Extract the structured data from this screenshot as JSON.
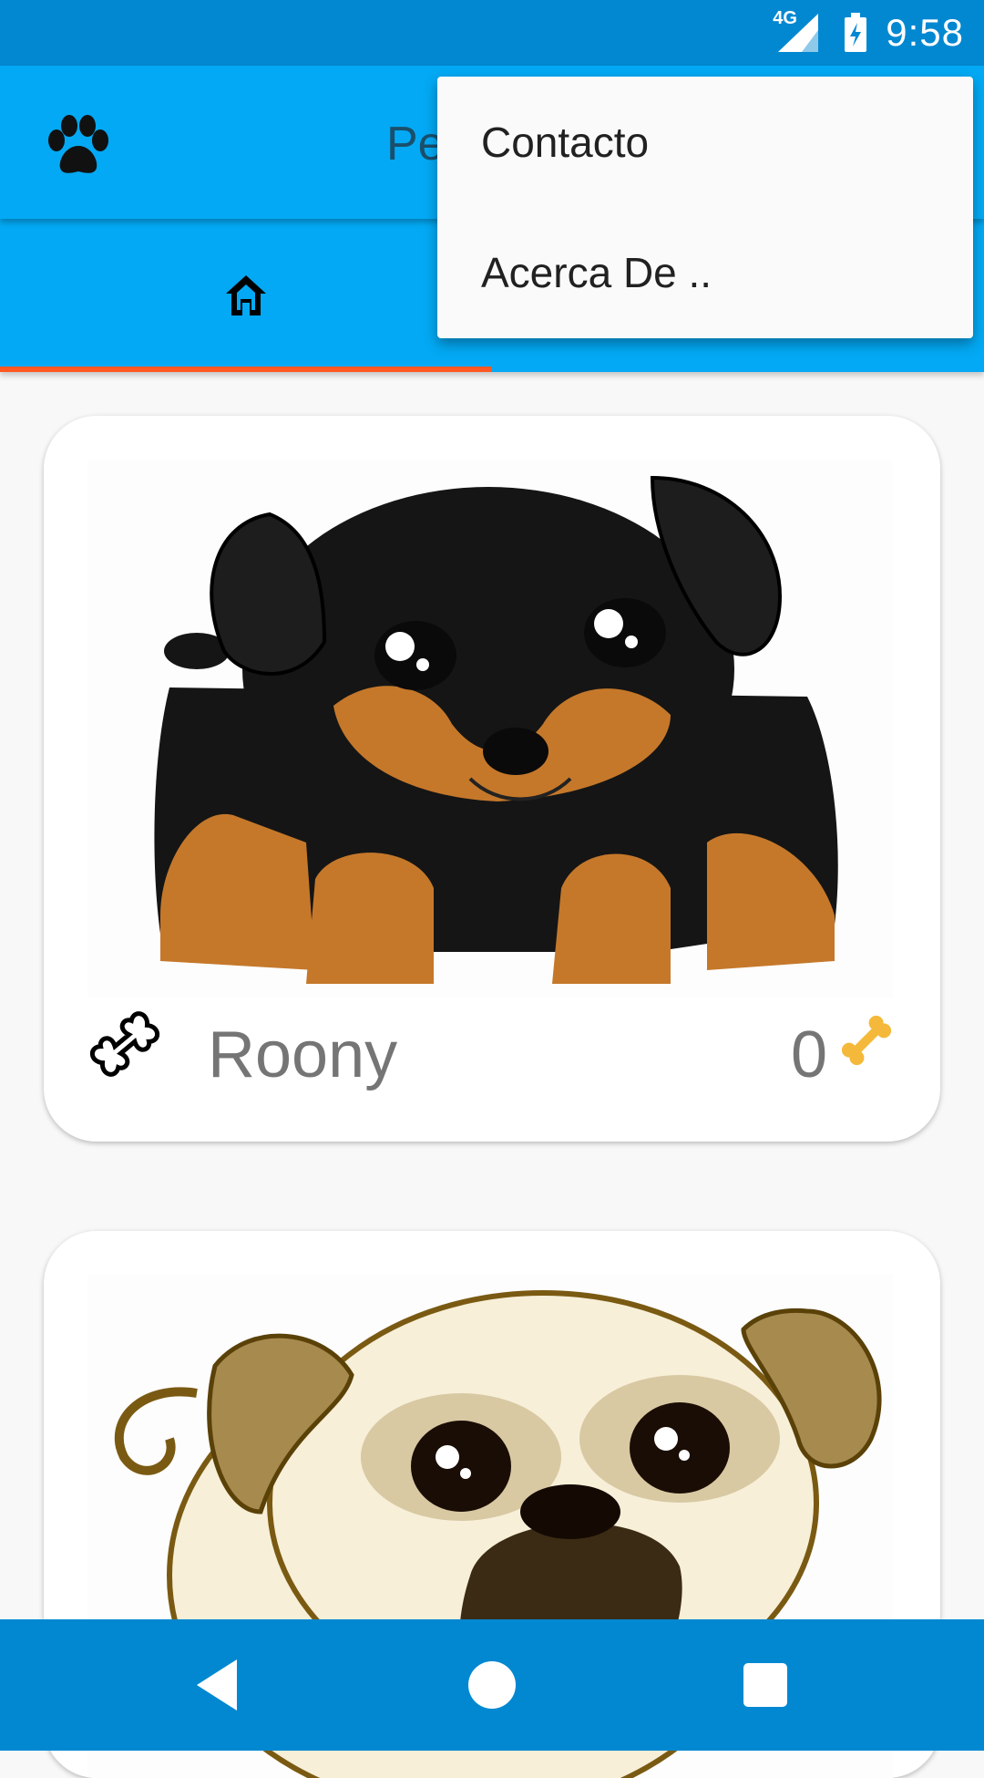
{
  "status_bar": {
    "network": "4G",
    "time": "9:58"
  },
  "app_bar": {
    "title": "Pe",
    "logo": "paw-icon"
  },
  "tabs": [
    {
      "icon": "home-icon",
      "selected": true
    },
    {
      "icon": "",
      "selected": false
    }
  ],
  "overflow_menu": {
    "items": [
      "Contacto",
      "Acerca De .."
    ]
  },
  "pets": [
    {
      "name": "Roony",
      "bones": "0",
      "image": "rottweiler-puppy"
    },
    {
      "name": "",
      "bones": "",
      "image": "pug-puppy"
    }
  ],
  "colors": {
    "status_bar": "#0288d1",
    "app_bar": "#03a9f4",
    "tab_indicator": "#ff5722",
    "nav_bar": "#0288d1"
  },
  "nav": [
    "back-icon",
    "home-circle-icon",
    "recents-icon"
  ]
}
